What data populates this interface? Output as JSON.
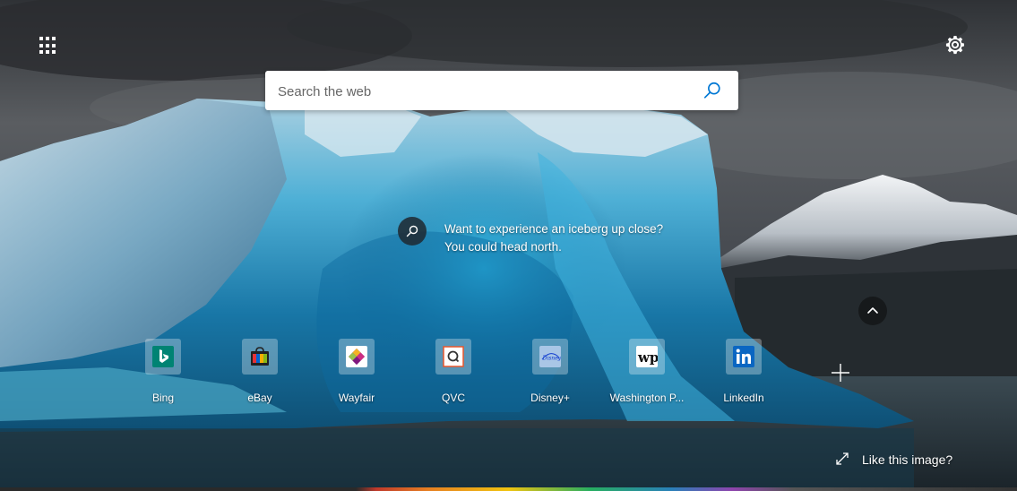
{
  "search": {
    "placeholder": "Search the web"
  },
  "image_info": {
    "line1": "Want to experience an iceberg up close?",
    "line2": "You could head north."
  },
  "quick_links": [
    {
      "label": "Bing",
      "icon": "bing-icon",
      "color": "#008373"
    },
    {
      "label": "eBay",
      "icon": "ebay-icon",
      "color": "#e53238"
    },
    {
      "label": "Wayfair",
      "icon": "wayfair-icon",
      "color": "#7f187f"
    },
    {
      "label": "QVC",
      "icon": "qvc-icon",
      "color": "#e8572d"
    },
    {
      "label": "Disney+",
      "icon": "disney-plus-icon",
      "color": "#113ccf"
    },
    {
      "label": "Washington P...",
      "icon": "washington-post-icon",
      "color": "#111111"
    },
    {
      "label": "LinkedIn",
      "icon": "linkedin-icon",
      "color": "#0a66c2"
    }
  ],
  "footer": {
    "like_image": "Like this image?"
  },
  "icons": {
    "apps": "app-launcher-icon",
    "settings": "gear-icon",
    "search": "search-icon",
    "image_info": "search-icon",
    "collapse": "chevron-up-icon",
    "add": "plus-icon",
    "expand": "expand-icon"
  },
  "colors": {
    "search_icon": "#0078d4",
    "text": "#ffffff"
  }
}
